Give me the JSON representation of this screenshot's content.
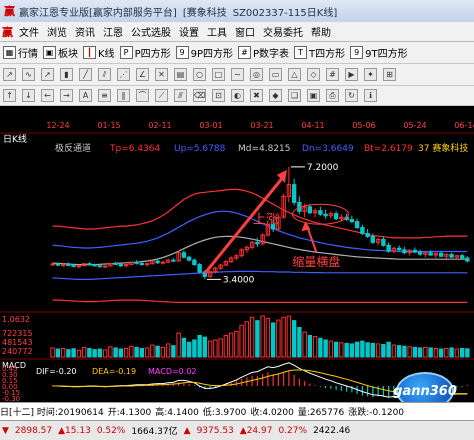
{
  "window": {
    "title_segments": [
      "赢家江恩专业版[赢家内部服务平台]",
      "[赛象科技",
      "SZ002337-115日K线]"
    ]
  },
  "menu": [
    "文件",
    "浏览",
    "资讯",
    "江恩",
    "公式选股",
    "设置",
    "工具",
    "窗口",
    "交易委托",
    "帮助"
  ],
  "toolbar1": [
    {
      "icon": "grid-icon",
      "label": "行情"
    },
    {
      "icon": "block-icon",
      "label": "板块"
    },
    {
      "icon": "candle-icon",
      "label": "K线"
    },
    {
      "icon": "p-icon",
      "label": "P四方形"
    },
    {
      "icon": "nine-p-icon",
      "label": "9P四方形"
    },
    {
      "icon": "p-digit-icon",
      "label": "P数字表"
    },
    {
      "icon": "t-icon",
      "label": "T四方形"
    },
    {
      "icon": "nine-t-icon",
      "label": "9T四方形"
    }
  ],
  "chart_header": {
    "period": "日K线",
    "indicator": "极反通道",
    "tp_label": "Tp=6.4364",
    "up_label": "Up=5.6788",
    "md_label": "Md=4.8215",
    "dn_label": "Dn=3.6649",
    "bt_label": "Bt=2.6179",
    "code_label": "37  赛象科技"
  },
  "colors": {
    "up": "#ff3030",
    "down": "#00c8c8",
    "tp_band": "#ff3030",
    "up_band": "#4060ff",
    "md_band": "#b0b0b0",
    "dn_band": "#4060ff",
    "bt_band": "#ff3030",
    "annotation": "#ff4040",
    "axis_text": "#ff4040"
  },
  "annotations": {
    "high_label": "7.2000",
    "low_label": "3.4000",
    "rise_text": "上涨",
    "consolidation_text": "缩量横盘"
  },
  "date_labels": [
    "12-24",
    "01-15",
    "02-11",
    "03-01",
    "03-21",
    "04-11",
    "05-06",
    "05-24",
    "06-14"
  ],
  "volume_panel": {
    "top_label": "1.0632",
    "ticks": [
      "722315",
      "481543",
      "240772"
    ]
  },
  "macd_panel": {
    "title": "MACD",
    "dif_label": "DIF=-0.20",
    "dea_label": "DEA=-0.19",
    "macd_label": "MACD=0.02",
    "ticks": [
      "0.45",
      "0.30",
      "0.15",
      "0.00",
      "-0.15",
      "-0.30"
    ]
  },
  "watermark": "gann360",
  "status_bar": {
    "left": "日[十二] 时间:20190614",
    "open": "开:4.1300",
    "high": "高:4.1400",
    "low": "低:3.9700",
    "close": "收:4.0200",
    "volume": "量:265776",
    "change": "涨跌:-0.1200"
  },
  "bottom_bar": {
    "index1_arrow": "▼",
    "index1": "2898.57",
    "index1_change": "▲15.13",
    "index1_pct": "0.52%",
    "index1_amount": "1664.37亿",
    "index2_arrow": "▲",
    "index2": "9375.53",
    "index2_change": "▲24.97",
    "index2_pct": "0.27%",
    "index2_amount": "2422.46"
  },
  "chart_data": {
    "type": "candlestick",
    "title": "",
    "ylim": [
      2.5,
      7.5
    ],
    "candles_ohlc": [
      [
        3.9,
        3.98,
        3.85,
        3.92
      ],
      [
        3.92,
        3.96,
        3.84,
        3.88
      ],
      [
        3.88,
        3.95,
        3.82,
        3.9
      ],
      [
        3.9,
        3.97,
        3.86,
        3.88
      ],
      [
        3.88,
        3.92,
        3.8,
        3.84
      ],
      [
        3.84,
        3.9,
        3.78,
        3.86
      ],
      [
        3.86,
        3.95,
        3.84,
        3.93
      ],
      [
        3.93,
        3.98,
        3.86,
        3.89
      ],
      [
        3.89,
        3.93,
        3.83,
        3.86
      ],
      [
        3.86,
        3.91,
        3.8,
        3.83
      ],
      [
        3.83,
        3.88,
        3.78,
        3.85
      ],
      [
        3.85,
        3.96,
        3.84,
        3.94
      ],
      [
        3.94,
        4.0,
        3.88,
        3.9
      ],
      [
        3.9,
        3.94,
        3.82,
        3.86
      ],
      [
        3.86,
        3.92,
        3.8,
        3.9
      ],
      [
        3.9,
        4.0,
        3.88,
        3.98
      ],
      [
        3.98,
        4.05,
        3.9,
        3.94
      ],
      [
        3.94,
        3.98,
        3.86,
        3.9
      ],
      [
        3.9,
        3.96,
        3.84,
        3.93
      ],
      [
        3.93,
        4.05,
        3.9,
        4.02
      ],
      [
        4.02,
        4.08,
        3.92,
        3.96
      ],
      [
        3.96,
        4.02,
        3.9,
        3.98
      ],
      [
        3.98,
        4.1,
        3.95,
        4.05
      ],
      [
        4.05,
        4.12,
        3.98,
        4.02
      ],
      [
        4.02,
        4.35,
        4.0,
        4.3
      ],
      [
        4.3,
        4.38,
        4.1,
        4.15
      ],
      [
        4.15,
        4.2,
        4.0,
        4.05
      ],
      [
        4.05,
        4.1,
        3.86,
        3.9
      ],
      [
        3.9,
        3.95,
        3.6,
        3.65
      ],
      [
        3.65,
        3.72,
        3.4,
        3.5
      ],
      [
        3.5,
        3.7,
        3.45,
        3.66
      ],
      [
        3.66,
        3.82,
        3.6,
        3.78
      ],
      [
        3.78,
        3.92,
        3.72,
        3.88
      ],
      [
        3.88,
        4.05,
        3.85,
        4.0
      ],
      [
        4.0,
        4.18,
        3.95,
        4.12
      ],
      [
        4.12,
        4.25,
        4.05,
        4.2
      ],
      [
        4.2,
        4.45,
        4.15,
        4.4
      ],
      [
        4.4,
        4.55,
        4.3,
        4.48
      ],
      [
        4.48,
        4.7,
        4.42,
        4.65
      ],
      [
        4.65,
        4.8,
        4.5,
        4.6
      ],
      [
        4.6,
        4.95,
        4.55,
        4.9
      ],
      [
        4.9,
        5.3,
        4.85,
        5.25
      ],
      [
        5.25,
        5.4,
        5.0,
        5.1
      ],
      [
        5.1,
        5.6,
        5.05,
        5.5
      ],
      [
        5.5,
        6.3,
        5.45,
        6.2
      ],
      [
        6.2,
        7.2,
        6.0,
        6.6
      ],
      [
        6.6,
        6.8,
        5.9,
        6.0
      ],
      [
        6.0,
        6.2,
        5.6,
        5.7
      ],
      [
        5.7,
        5.95,
        5.5,
        5.85
      ],
      [
        5.85,
        5.95,
        5.6,
        5.65
      ],
      [
        5.65,
        5.8,
        5.5,
        5.72
      ],
      [
        5.72,
        5.85,
        5.55,
        5.6
      ],
      [
        5.6,
        5.75,
        5.45,
        5.55
      ],
      [
        5.55,
        5.7,
        5.45,
        5.62
      ],
      [
        5.62,
        5.7,
        5.4,
        5.45
      ],
      [
        5.45,
        5.6,
        5.35,
        5.5
      ],
      [
        5.5,
        5.62,
        5.38,
        5.42
      ],
      [
        5.42,
        5.55,
        5.3,
        5.35
      ],
      [
        5.35,
        5.45,
        5.1,
        5.15
      ],
      [
        5.15,
        5.25,
        4.9,
        4.95
      ],
      [
        4.95,
        5.1,
        4.8,
        4.85
      ],
      [
        4.85,
        4.95,
        4.6,
        4.65
      ],
      [
        4.65,
        4.8,
        4.55,
        4.75
      ],
      [
        4.75,
        4.85,
        4.5,
        4.55
      ],
      [
        4.55,
        4.65,
        4.3,
        4.35
      ],
      [
        4.35,
        4.5,
        4.28,
        4.45
      ],
      [
        4.45,
        4.55,
        4.35,
        4.4
      ],
      [
        4.4,
        4.5,
        4.25,
        4.3
      ],
      [
        4.3,
        4.42,
        4.2,
        4.38
      ],
      [
        4.38,
        4.48,
        4.28,
        4.32
      ],
      [
        4.32,
        4.4,
        4.2,
        4.25
      ],
      [
        4.25,
        4.35,
        4.15,
        4.3
      ],
      [
        4.3,
        4.38,
        4.2,
        4.22
      ],
      [
        4.22,
        4.3,
        4.12,
        4.28
      ],
      [
        4.28,
        4.35,
        4.15,
        4.18
      ],
      [
        4.18,
        4.28,
        4.1,
        4.24
      ],
      [
        4.24,
        4.3,
        4.12,
        4.15
      ],
      [
        4.15,
        4.22,
        4.05,
        4.2
      ],
      [
        4.2,
        4.26,
        4.08,
        4.12
      ],
      [
        4.12,
        4.18,
        3.97,
        4.02
      ]
    ],
    "volume": [
      160,
      140,
      150,
      130,
      145,
      120,
      170,
      150,
      130,
      140,
      125,
      180,
      160,
      140,
      150,
      190,
      170,
      150,
      160,
      210,
      190,
      170,
      230,
      200,
      420,
      330,
      260,
      300,
      380,
      350,
      280,
      300,
      320,
      380,
      420,
      450,
      560,
      620,
      700,
      640,
      722,
      680,
      600,
      650,
      700,
      720,
      640,
      520,
      440,
      380,
      360,
      330,
      300,
      280,
      260,
      250,
      240,
      230,
      260,
      280,
      250,
      240,
      230,
      220,
      260,
      210,
      200,
      190,
      180,
      170,
      160,
      170,
      160,
      150,
      140,
      150,
      160,
      140,
      150,
      145
    ],
    "bands": {
      "tp": [
        5.2,
        5.2,
        5.18,
        5.16,
        5.14,
        5.12,
        5.1,
        5.1,
        5.1,
        5.12,
        5.14,
        5.16,
        5.18,
        5.2,
        5.2,
        5.22,
        5.24,
        5.28,
        5.32,
        5.38,
        5.46,
        5.56,
        5.68,
        5.82,
        5.96,
        6.1,
        6.2,
        6.28,
        6.32,
        6.34,
        6.36,
        6.38,
        6.4,
        6.42,
        6.44,
        6.44,
        6.42,
        6.38,
        6.32,
        6.24,
        6.14,
        6.04,
        5.94,
        5.84,
        5.74,
        5.66,
        5.58,
        5.5,
        5.44,
        5.38,
        5.32,
        5.28,
        5.24,
        5.2,
        5.16,
        5.12,
        5.08,
        5.04,
        5.0,
        4.96,
        4.92,
        4.88,
        4.86,
        4.84,
        4.82,
        4.8,
        4.8,
        4.8,
        4.8,
        4.8,
        4.8,
        4.82,
        4.82,
        4.84,
        4.84,
        4.86,
        4.86,
        4.86,
        4.86,
        4.86
      ],
      "up": [
        4.55,
        4.54,
        4.52,
        4.5,
        4.48,
        4.47,
        4.46,
        4.46,
        4.47,
        4.48,
        4.5,
        4.52,
        4.54,
        4.56,
        4.58,
        4.6,
        4.62,
        4.65,
        4.69,
        4.74,
        4.8,
        4.88,
        4.96,
        5.06,
        5.16,
        5.26,
        5.36,
        5.44,
        5.52,
        5.58,
        5.64,
        5.68,
        5.7,
        5.7,
        5.68,
        5.64,
        5.58,
        5.52,
        5.44,
        5.36,
        5.28,
        5.2,
        5.12,
        5.04,
        4.98,
        4.92,
        4.86,
        4.8,
        4.76,
        4.72,
        4.68,
        4.64,
        4.6,
        4.57,
        4.54,
        4.51,
        4.48,
        4.46,
        4.44,
        4.42,
        4.4,
        4.39,
        4.38,
        4.37,
        4.36,
        4.35,
        4.34,
        4.34,
        4.34,
        4.34,
        4.34,
        4.34,
        4.34,
        4.34,
        4.34,
        4.34,
        4.34,
        4.34,
        4.34,
        4.34
      ],
      "md": [
        3.95,
        3.94,
        3.93,
        3.92,
        3.91,
        3.9,
        3.9,
        3.9,
        3.9,
        3.91,
        3.92,
        3.93,
        3.94,
        3.95,
        3.96,
        3.97,
        3.98,
        4.0,
        4.02,
        4.05,
        4.09,
        4.14,
        4.2,
        4.27,
        4.35,
        4.44,
        4.52,
        4.6,
        4.67,
        4.73,
        4.78,
        4.82,
        4.84,
        4.85,
        4.85,
        4.84,
        4.82,
        4.79,
        4.76,
        4.72,
        4.68,
        4.64,
        4.6,
        4.56,
        4.52,
        4.48,
        4.44,
        4.41,
        4.38,
        4.35,
        4.32,
        4.3,
        4.28,
        4.26,
        4.24,
        4.22,
        4.2,
        4.18,
        4.16,
        4.15,
        4.14,
        4.13,
        4.12,
        4.11,
        4.1,
        4.09,
        4.08,
        4.08,
        4.08,
        4.08,
        4.08,
        4.08,
        4.08,
        4.08,
        4.08,
        4.08,
        4.08,
        4.08,
        4.08,
        4.08
      ],
      "dn": [
        3.45,
        3.44,
        3.43,
        3.42,
        3.41,
        3.4,
        3.4,
        3.4,
        3.41,
        3.42,
        3.43,
        3.44,
        3.45,
        3.46,
        3.47,
        3.48,
        3.49,
        3.5,
        3.51,
        3.52,
        3.53,
        3.54,
        3.55,
        3.56,
        3.57,
        3.58,
        3.59,
        3.6,
        3.61,
        3.62,
        3.63,
        3.64,
        3.65,
        3.66,
        3.66,
        3.67,
        3.67,
        3.67,
        3.67,
        3.67,
        3.66,
        3.66,
        3.66,
        3.65,
        3.65,
        3.65,
        3.64,
        3.64,
        3.64,
        3.63,
        3.63,
        3.63,
        3.62,
        3.62,
        3.62,
        3.62,
        3.62,
        3.62,
        3.62,
        3.62,
        3.62,
        3.62,
        3.62,
        3.62,
        3.62,
        3.62,
        3.62,
        3.62,
        3.62,
        3.62,
        3.62,
        3.62,
        3.62,
        3.62,
        3.62,
        3.62,
        3.62,
        3.62,
        3.62,
        3.62
      ],
      "bt": [
        2.7,
        2.7,
        2.69,
        2.68,
        2.67,
        2.66,
        2.65,
        2.65,
        2.65,
        2.66,
        2.67,
        2.68,
        2.69,
        2.7,
        2.7,
        2.7,
        2.7,
        2.69,
        2.68,
        2.67,
        2.66,
        2.65,
        2.64,
        2.63,
        2.62,
        2.62,
        2.62,
        2.62,
        2.62,
        2.62,
        2.62,
        2.62,
        2.62,
        2.62,
        2.62,
        2.62,
        2.62,
        2.62,
        2.62,
        2.62,
        2.62,
        2.62,
        2.62,
        2.62,
        2.62,
        2.62,
        2.62,
        2.62,
        2.62,
        2.62,
        2.62,
        2.62,
        2.62,
        2.62,
        2.62,
        2.62,
        2.62,
        2.62,
        2.62,
        2.62,
        2.62,
        2.62,
        2.62,
        2.62,
        2.62,
        2.62,
        2.62,
        2.62,
        2.62,
        2.62,
        2.62,
        2.62,
        2.62,
        2.62,
        2.62,
        2.62,
        2.62,
        2.62,
        2.62,
        2.62
      ]
    },
    "macd_hist": [
      0.02,
      0.02,
      0.01,
      0.0,
      -0.01,
      -0.01,
      0.0,
      0.01,
      0.01,
      0.0,
      -0.01,
      0.01,
      0.02,
      0.02,
      0.01,
      0.03,
      0.03,
      0.02,
      0.02,
      0.04,
      0.04,
      0.03,
      0.05,
      0.05,
      0.1,
      0.08,
      0.05,
      0.02,
      -0.04,
      -0.08,
      -0.06,
      -0.03,
      0.0,
      0.04,
      0.08,
      0.12,
      0.18,
      0.22,
      0.26,
      0.25,
      0.3,
      0.34,
      0.3,
      0.32,
      0.36,
      0.38,
      0.28,
      0.18,
      0.12,
      0.06,
      0.02,
      -0.02,
      -0.05,
      -0.07,
      -0.1,
      -0.12,
      -0.14,
      -0.16,
      -0.2,
      -0.24,
      -0.26,
      -0.28,
      -0.26,
      -0.27,
      -0.28,
      -0.24,
      -0.22,
      -0.2,
      -0.18,
      -0.16,
      -0.14,
      -0.12,
      -0.1,
      -0.08,
      -0.06,
      -0.05,
      -0.04,
      -0.03,
      -0.02,
      0.02
    ],
    "dif": [
      0.0,
      0.0,
      -0.01,
      -0.01,
      -0.02,
      -0.02,
      -0.01,
      0.0,
      0.0,
      -0.01,
      -0.02,
      -0.01,
      0.0,
      0.01,
      0.01,
      0.02,
      0.03,
      0.03,
      0.03,
      0.05,
      0.06,
      0.06,
      0.08,
      0.09,
      0.14,
      0.14,
      0.12,
      0.08,
      0.0,
      -0.06,
      -0.06,
      -0.04,
      0.0,
      0.05,
      0.1,
      0.15,
      0.22,
      0.28,
      0.34,
      0.36,
      0.42,
      0.48,
      0.46,
      0.49,
      0.54,
      0.58,
      0.52,
      0.44,
      0.38,
      0.32,
      0.27,
      0.22,
      0.17,
      0.13,
      0.08,
      0.04,
      0.0,
      -0.04,
      -0.09,
      -0.14,
      -0.18,
      -0.22,
      -0.23,
      -0.25,
      -0.28,
      -0.26,
      -0.26,
      -0.25,
      -0.25,
      -0.24,
      -0.23,
      -0.23,
      -0.22,
      -0.22,
      -0.21,
      -0.21,
      -0.21,
      -0.2,
      -0.2,
      -0.2
    ],
    "dea": [
      0.0,
      0.0,
      0.0,
      -0.01,
      -0.01,
      -0.01,
      -0.01,
      -0.01,
      -0.01,
      -0.01,
      -0.01,
      -0.01,
      -0.01,
      0.0,
      0.0,
      0.0,
      0.01,
      0.01,
      0.02,
      0.02,
      0.03,
      0.03,
      0.04,
      0.05,
      0.06,
      0.08,
      0.09,
      0.09,
      0.07,
      0.04,
      0.02,
      0.01,
      0.01,
      0.02,
      0.03,
      0.05,
      0.08,
      0.11,
      0.14,
      0.17,
      0.2,
      0.24,
      0.27,
      0.3,
      0.34,
      0.38,
      0.4,
      0.4,
      0.4,
      0.38,
      0.36,
      0.33,
      0.3,
      0.27,
      0.24,
      0.2,
      0.17,
      0.13,
      0.09,
      0.05,
      0.01,
      -0.03,
      -0.06,
      -0.09,
      -0.12,
      -0.14,
      -0.16,
      -0.18,
      -0.19,
      -0.2,
      -0.2,
      -0.2,
      -0.2,
      -0.2,
      -0.2,
      -0.19,
      -0.19,
      -0.19,
      -0.19,
      -0.19
    ]
  }
}
